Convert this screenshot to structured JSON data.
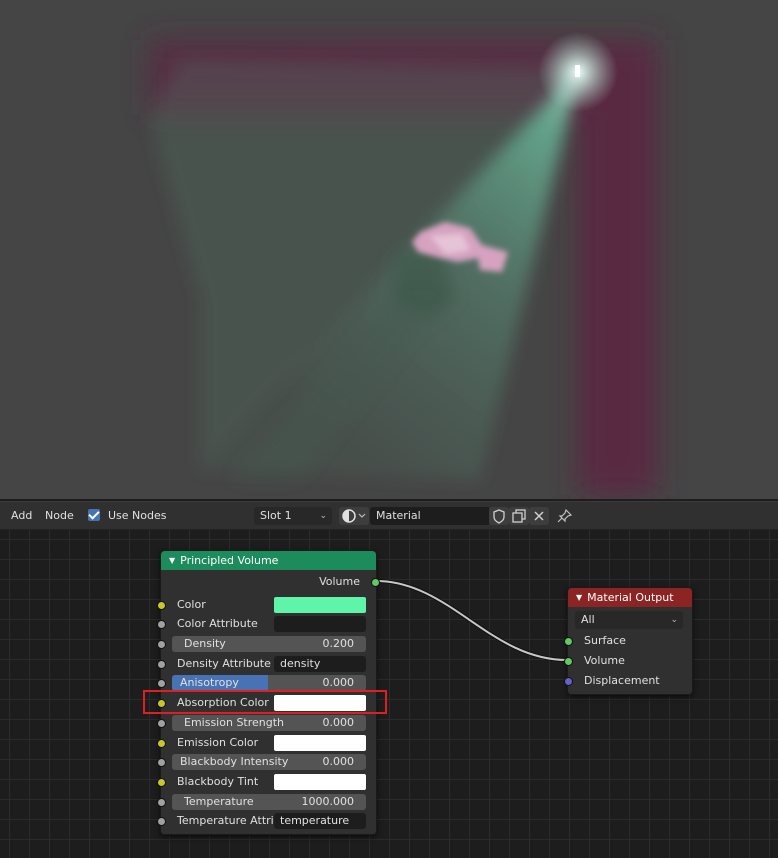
{
  "header": {
    "menu_add": "Add",
    "menu_node": "Node",
    "use_nodes_label": "Use Nodes",
    "use_nodes_checked": true,
    "slot": "Slot 1",
    "material_name": "Material",
    "icons": [
      "material-sphere-icon",
      "fake-user-shield-icon",
      "duplicate-icon",
      "unlink-x-icon",
      "pin-icon"
    ]
  },
  "principled_volume": {
    "title": "Principled Volume",
    "header_color": "#1d8c5c",
    "output_volume": "Volume",
    "color_label": "Color",
    "color_value": "#5ef5a8",
    "color_attribute_label": "Color Attribute",
    "color_attribute_value": "",
    "density_label": "Density",
    "density_value": "0.200",
    "density_attribute_label": "Density Attribute",
    "density_attribute_value": "density",
    "anisotropy_label": "Anisotropy",
    "anisotropy_value": "0.000",
    "absorption_color_label": "Absorption Color",
    "absorption_color_value": "#ffffff",
    "emission_strength_label": "Emission Strength",
    "emission_strength_value": "0.000",
    "emission_color_label": "Emission Color",
    "emission_color_value": "#ffffff",
    "blackbody_intensity_label": "Blackbody Intensity",
    "blackbody_intensity_value": "0.000",
    "blackbody_tint_label": "Blackbody Tint",
    "blackbody_tint_value": "#ffffff",
    "temperature_label": "Temperature",
    "temperature_value": "1000.000",
    "temperature_attribute_label": "Temperature Attri..",
    "temperature_attribute_value": "temperature"
  },
  "material_output": {
    "title": "Material Output",
    "header_color": "#8c2424",
    "target": "All",
    "surface_label": "Surface",
    "volume_label": "Volume",
    "displacement_label": "Displacement"
  },
  "colors": {
    "socket_color": "#c7c729",
    "socket_float": "#a1a1a1",
    "socket_shader": "#63c763",
    "socket_vector": "#6363c7",
    "highlight_box": "#e02020",
    "accent": "#4772b3"
  }
}
